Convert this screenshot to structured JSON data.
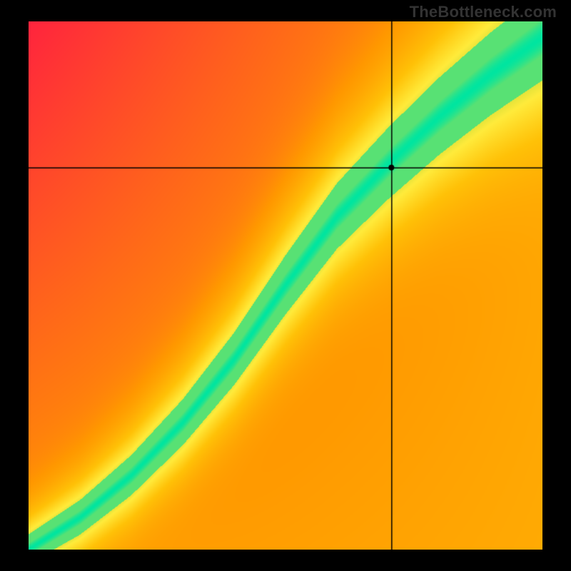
{
  "watermark": "TheBottleneck.com",
  "chart_data": {
    "type": "heatmap",
    "title": "",
    "xlabel": "",
    "ylabel": "",
    "xlim": [
      0,
      1
    ],
    "ylim": [
      0,
      1
    ],
    "crosshair": {
      "x": 0.707,
      "y": 0.723
    },
    "marker": {
      "x": 0.707,
      "y": 0.723,
      "radius": 4
    },
    "ridge": {
      "description": "Green optimal band along an S-curve from bottom-left to top-right",
      "points": [
        {
          "x": 0.0,
          "y": 0.0
        },
        {
          "x": 0.1,
          "y": 0.06
        },
        {
          "x": 0.2,
          "y": 0.14
        },
        {
          "x": 0.3,
          "y": 0.24
        },
        {
          "x": 0.4,
          "y": 0.36
        },
        {
          "x": 0.5,
          "y": 0.5
        },
        {
          "x": 0.6,
          "y": 0.63
        },
        {
          "x": 0.7,
          "y": 0.73
        },
        {
          "x": 0.8,
          "y": 0.82
        },
        {
          "x": 0.9,
          "y": 0.9
        },
        {
          "x": 1.0,
          "y": 0.97
        }
      ]
    },
    "colormap": {
      "stops": [
        {
          "t": 0.0,
          "color": "#ff1744"
        },
        {
          "t": 0.25,
          "color": "#ff5722"
        },
        {
          "t": 0.5,
          "color": "#ff9800"
        },
        {
          "t": 0.7,
          "color": "#ffc107"
        },
        {
          "t": 0.85,
          "color": "#ffeb3b"
        },
        {
          "t": 0.93,
          "color": "#cddc39"
        },
        {
          "t": 1.0,
          "color": "#00e5a0"
        }
      ]
    },
    "field": {
      "description": "Value at (x,y) is high near ridge and decays toward red with distance; upper-left biased red, lower-right biased orange/yellow",
      "biasUpperLeft": -0.55,
      "biasLowerRight": 0.15,
      "ridgeSharpness": 9.0
    },
    "grid": false,
    "legend": false
  }
}
